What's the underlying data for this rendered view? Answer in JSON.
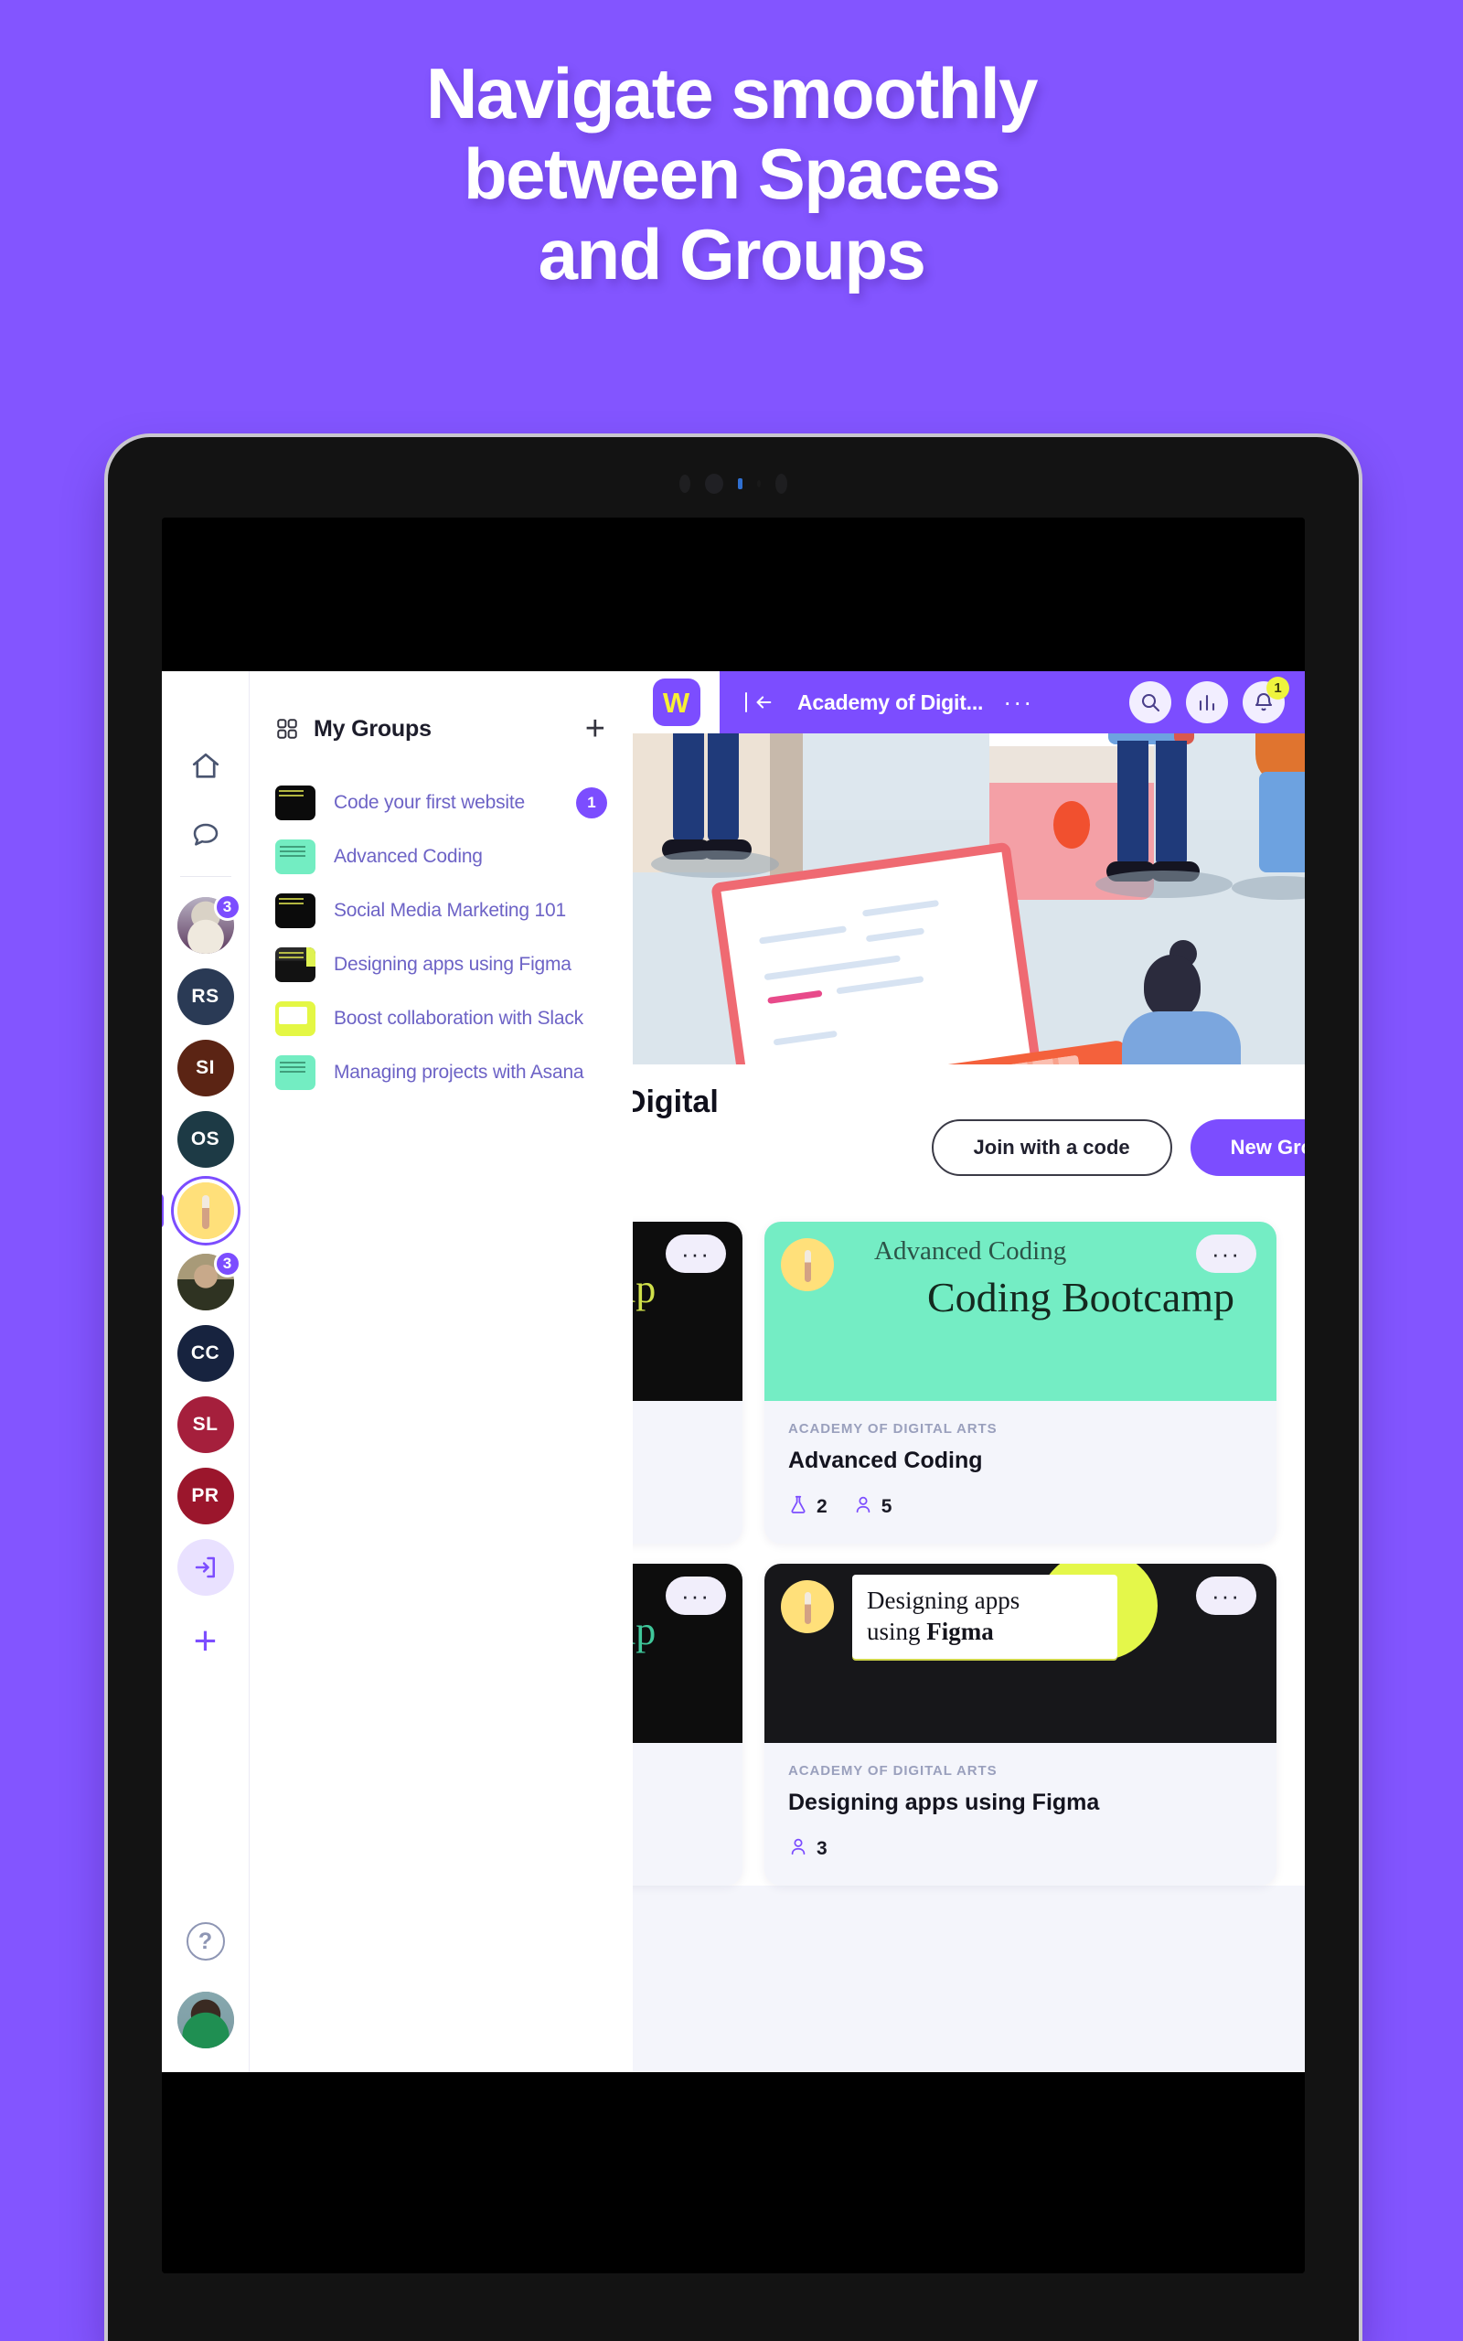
{
  "promo": {
    "headline_lines": [
      "Navigate smoothly",
      "between Spaces",
      "and Groups"
    ],
    "bg_color": "#8355ff"
  },
  "appbar": {
    "logo_letter": "W",
    "collapse_icon": "collapse-sidebar-icon",
    "title": "Academy of Digit...",
    "overflow": "···",
    "actions": [
      {
        "name": "search-icon",
        "label": ""
      },
      {
        "name": "stats-icon",
        "label": ""
      },
      {
        "name": "bell-icon",
        "label": "",
        "badge": "1"
      }
    ],
    "accent": "#7c4dff"
  },
  "rail": {
    "home_icon": "home-icon",
    "chat_icon": "chat-bubble-icon",
    "spaces": [
      {
        "name": "space-avatar-photo-1",
        "initials": "",
        "type": "photo",
        "photo": "ph-a",
        "badge": "3",
        "active": false,
        "color": "#b9b2c4"
      },
      {
        "name": "space-rs",
        "initials": "RS",
        "type": "initials",
        "badge": "",
        "active": false,
        "color": "#2a3a55"
      },
      {
        "name": "space-si",
        "initials": "SI",
        "type": "initials",
        "badge": "",
        "active": false,
        "color": "#5b2414"
      },
      {
        "name": "space-os",
        "initials": "OS",
        "type": "initials",
        "badge": "",
        "active": false,
        "color": "#1d3a45"
      },
      {
        "name": "space-active-academy",
        "initials": "",
        "type": "photo",
        "photo": "ph-y",
        "badge": "",
        "active": true,
        "color": "#ffe07a"
      },
      {
        "name": "space-avatar-photo-2",
        "initials": "",
        "type": "photo",
        "photo": "ph-b",
        "badge": "3",
        "active": false,
        "color": "#a89a78"
      },
      {
        "name": "space-cc",
        "initials": "CC",
        "type": "initials",
        "badge": "",
        "active": false,
        "color": "#17233f"
      },
      {
        "name": "space-sl",
        "initials": "SL",
        "type": "initials",
        "badge": "",
        "active": false,
        "color": "#a51f3c"
      },
      {
        "name": "space-pr",
        "initials": "PR",
        "type": "initials",
        "badge": "",
        "active": false,
        "color": "#9b162c"
      }
    ],
    "join_space_icon": "enter-space-icon",
    "add_space_label": "+",
    "help_label": "?",
    "user_avatar": "user-avatar"
  },
  "groups_panel": {
    "title": "My Groups",
    "grid_icon": "grid-icon",
    "add_label": "+",
    "items": [
      {
        "name": "Code your first website",
        "thumb": "th-black",
        "badge": "1"
      },
      {
        "name": "Advanced Coding",
        "thumb": "th-mint",
        "badge": ""
      },
      {
        "name": "Social Media Marketing 101",
        "thumb": "th-black",
        "badge": ""
      },
      {
        "name": "Designing apps using Figma",
        "thumb": "th-blacklime",
        "badge": ""
      },
      {
        "name": "Boost collaboration with Slack",
        "thumb": "th-lime",
        "badge": ""
      },
      {
        "name": "Managing projects with Asana",
        "thumb": "th-mint",
        "badge": ""
      }
    ]
  },
  "main": {
    "space_title": "y of Digital",
    "join_button": "Join with a code",
    "new_group_button": "New Group",
    "cards": [
      {
        "kind": "partial",
        "cover_style": "cover-black",
        "cover_text": "camp",
        "cover_text_color": "#cfe04a",
        "menu": "···",
        "eyebrow": "",
        "title": "",
        "meta": []
      },
      {
        "kind": "full",
        "cover_style": "cover-mint",
        "cover_line1": "Advanced Coding",
        "cover_line2": "Coding Bootcamp",
        "menu": "···",
        "eyebrow": "ACADEMY OF DIGITAL ARTS",
        "title": "Advanced Coding",
        "meta": [
          {
            "icon": "flask-icon",
            "value": "2"
          },
          {
            "icon": "person-icon",
            "value": "5"
          }
        ]
      },
      {
        "kind": "partial",
        "cover_style": "cover-black",
        "cover_text": "camp",
        "cover_text_color": "#3fc79a",
        "menu": "···",
        "eyebrow": "",
        "title": "",
        "meta": []
      },
      {
        "kind": "full",
        "cover_style": "cover-dark",
        "cover_label_line1": "Designing apps",
        "cover_label_line2a": "using ",
        "cover_label_line2b": "Figma",
        "menu": "···",
        "eyebrow": "ACADEMY OF DIGITAL ARTS",
        "title": "Designing apps using Figma",
        "meta": [
          {
            "icon": "person-icon",
            "value": "3"
          }
        ]
      }
    ]
  }
}
